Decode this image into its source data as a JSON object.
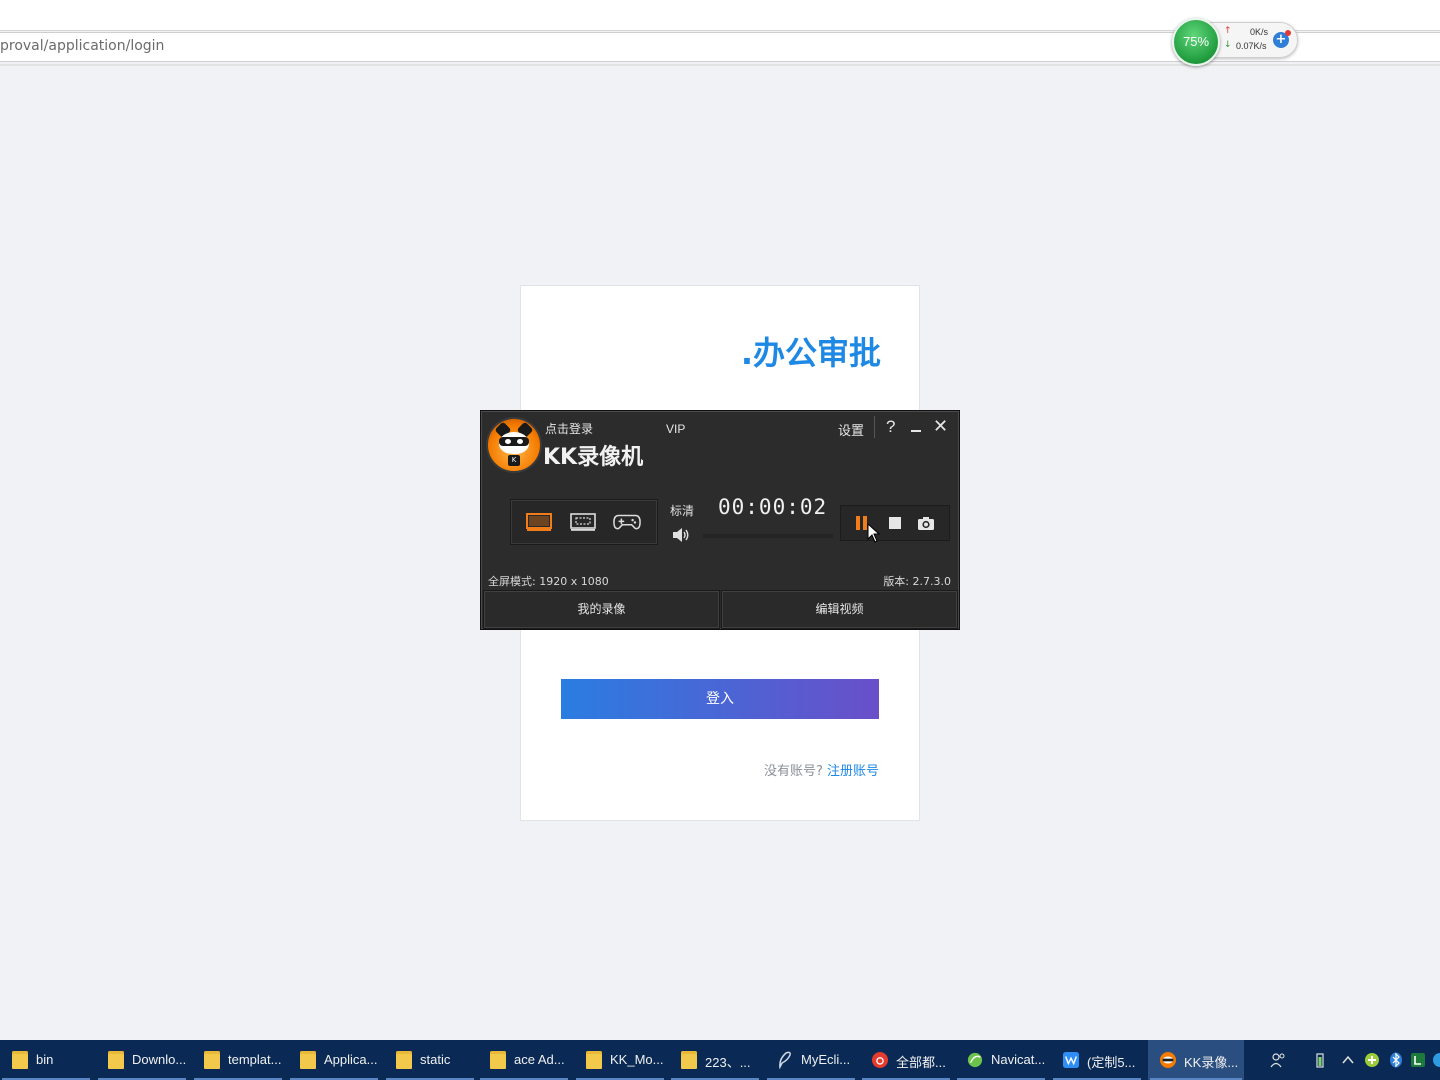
{
  "browser": {
    "url": "proval/application/login"
  },
  "net_meter": {
    "percent": "75%",
    "upload": "0K/s",
    "download": "0.07K/s"
  },
  "login": {
    "title": ".办公审批",
    "login_button": "登入",
    "no_account": "没有账号?",
    "register_link": "注册账号"
  },
  "recorder": {
    "login_prompt": "点击登录",
    "vip": "VIP",
    "app_name": "KK录像机",
    "settings": "设置",
    "help": "?",
    "close": "✕",
    "quality": "标清",
    "timer": "00:00:02",
    "mode_info": "全屏模式: 1920 x 1080",
    "version": "版本: 2.7.3.0",
    "my_recordings": "我的录像",
    "edit_video": "编辑视频",
    "accent_color": "#f07c1a"
  },
  "taskbar": {
    "items": [
      {
        "label": "bin",
        "icon": "folder-icon"
      },
      {
        "label": "Downlo...",
        "icon": "folder-icon"
      },
      {
        "label": "templat...",
        "icon": "folder-icon"
      },
      {
        "label": "Applica...",
        "icon": "folder-icon"
      },
      {
        "label": "static",
        "icon": "folder-icon"
      },
      {
        "label": "ace Ad...",
        "icon": "folder-icon"
      },
      {
        "label": "KK_Mo...",
        "icon": "folder-icon"
      },
      {
        "label": "223、...",
        "icon": "folder-icon"
      },
      {
        "label": "MyEcli...",
        "icon": "myeclipse-icon"
      },
      {
        "label": "全部都...",
        "icon": "netease-music-icon"
      },
      {
        "label": "Navicat...",
        "icon": "navicat-icon"
      },
      {
        "label": "(定制5...",
        "icon": "wps-icon"
      },
      {
        "label": "KK录像...",
        "icon": "kk-recorder-icon"
      }
    ],
    "color": "#0a2a55"
  }
}
